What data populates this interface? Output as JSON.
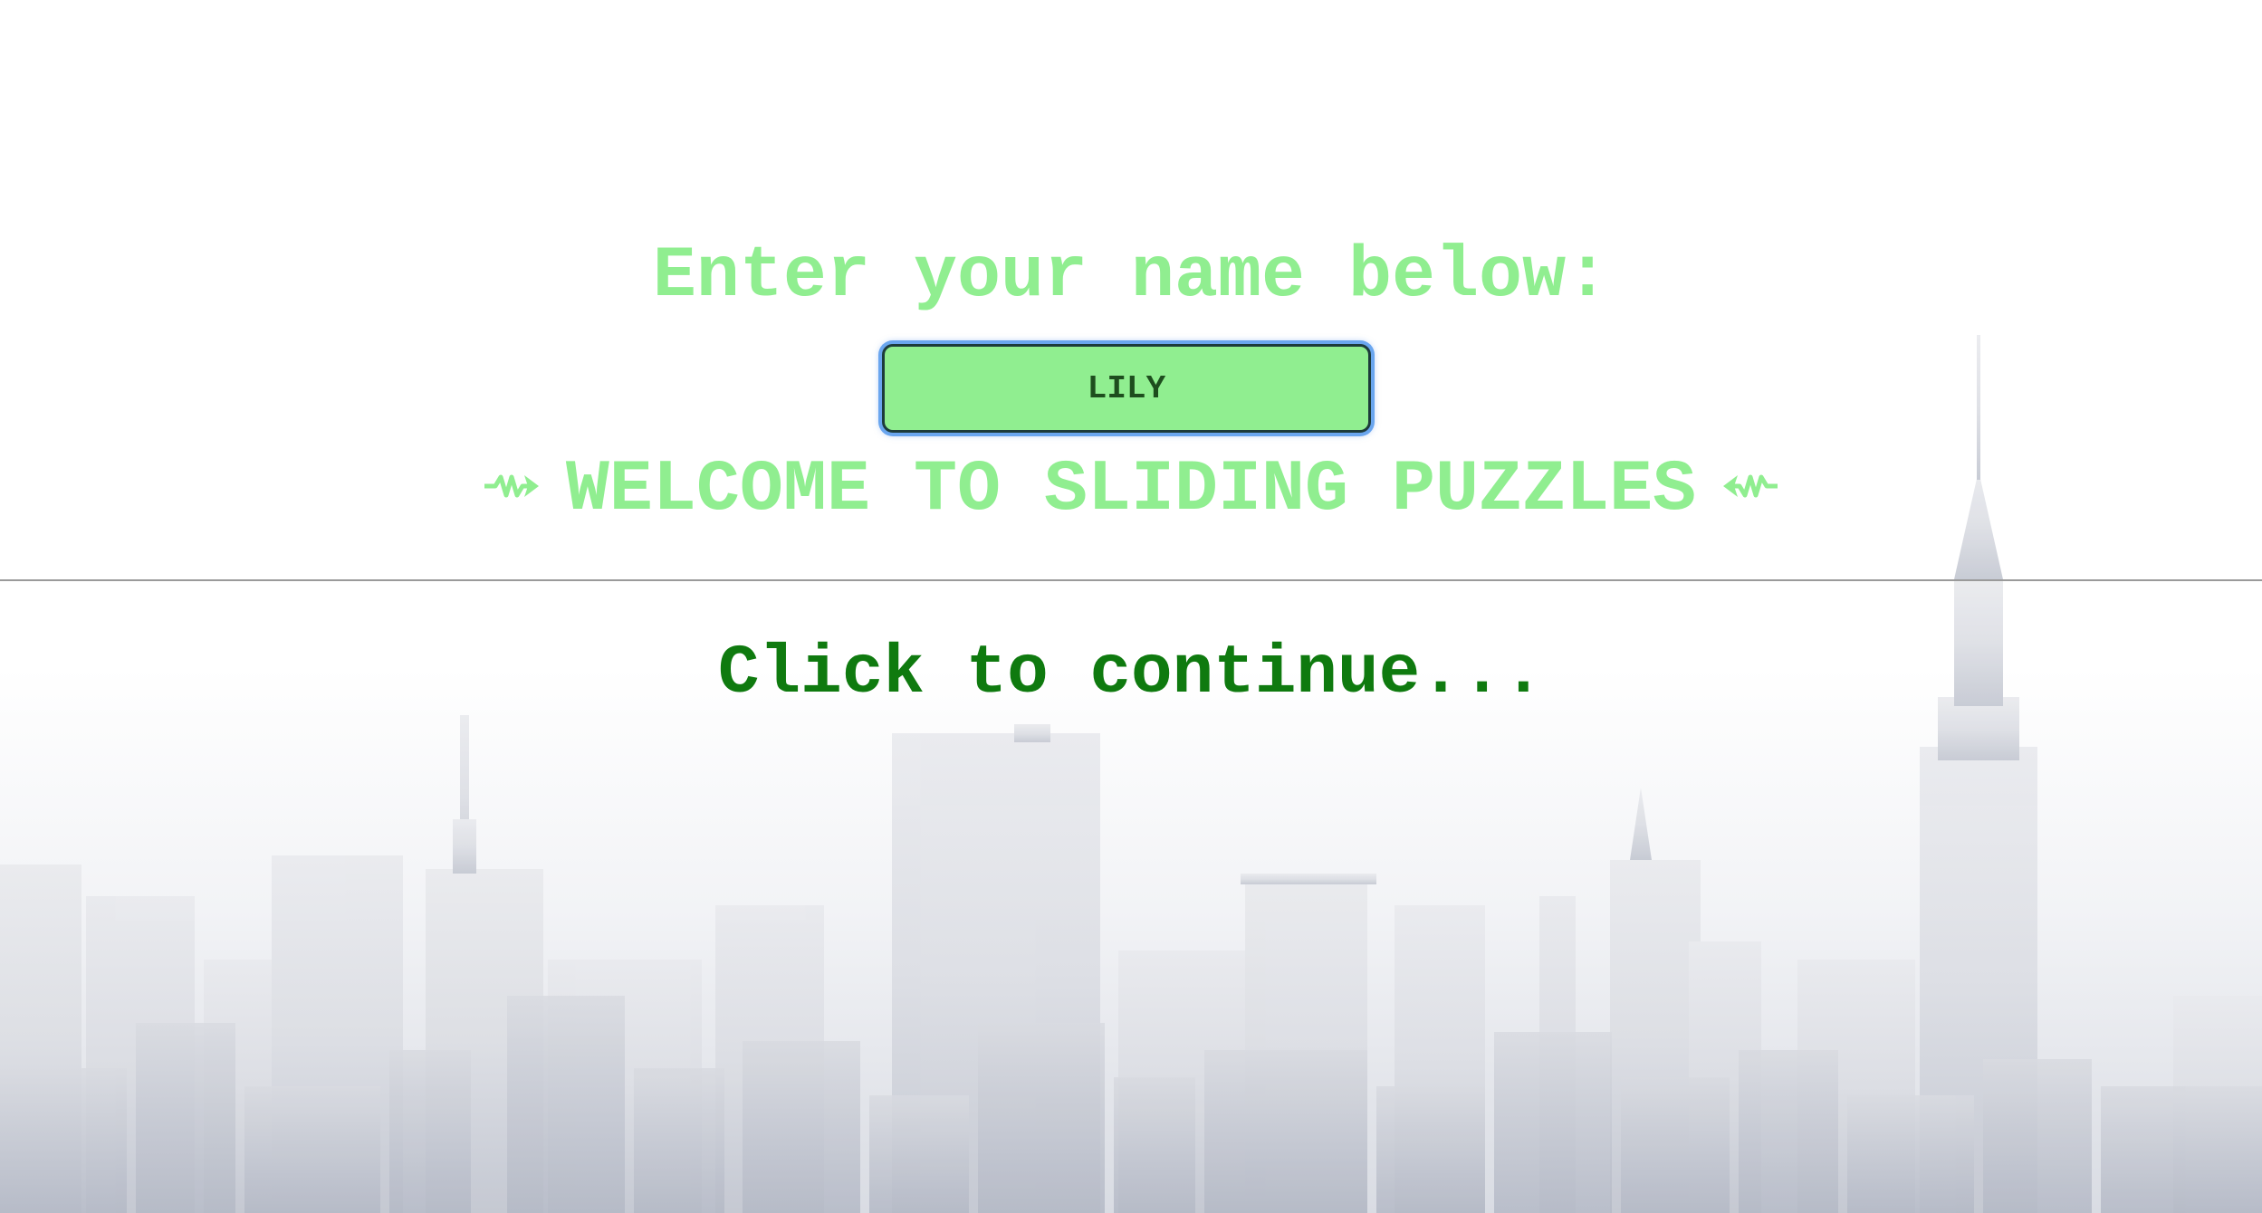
{
  "screen": {
    "prompt_text": "Enter your name below:",
    "name_input": {
      "value": "LILY"
    },
    "welcome_text": "WELCOME TO SLIDING PUZZLES",
    "continue_text": "Click to continue..."
  },
  "colors": {
    "light_green": "#90ee90",
    "dark_green": "#0f7a0f",
    "input_text": "#1e4d1e",
    "focus_ring": "#6aa6ef",
    "divider": "#9a9a9a",
    "skyline": "#c4c8d2"
  },
  "icons": {
    "left_decoration": "squiggle-arrow-right-icon",
    "right_decoration": "squiggle-arrow-left-icon",
    "background": "city-skyline-image"
  }
}
